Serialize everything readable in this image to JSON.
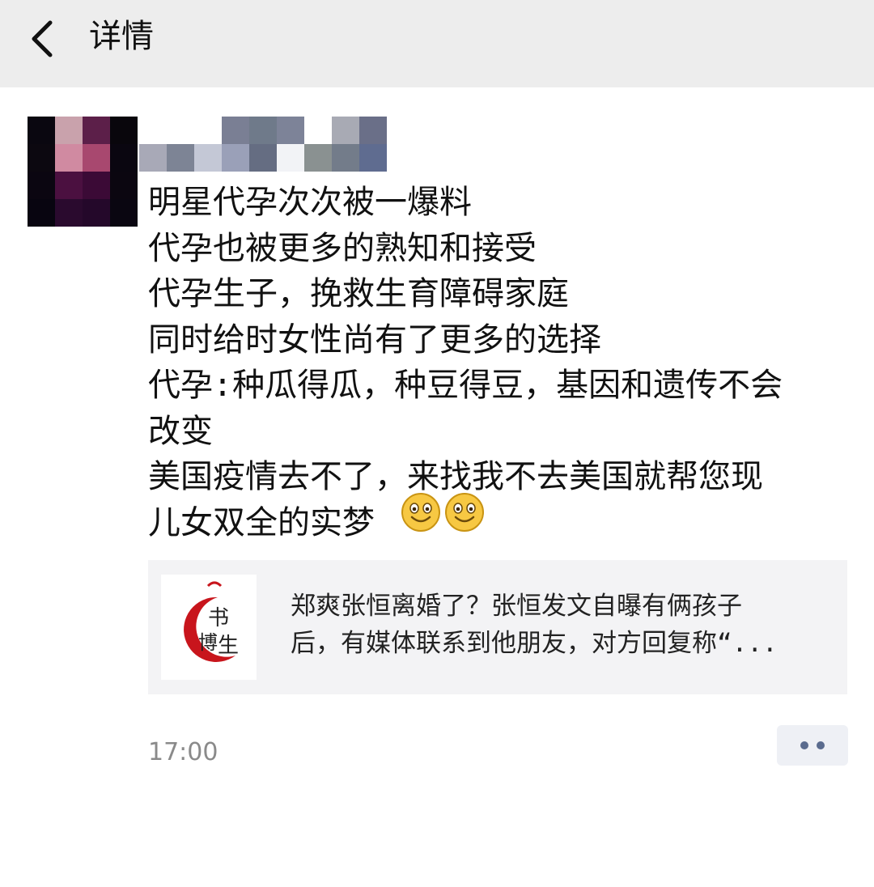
{
  "header": {
    "back_icon": "chevron-left-icon",
    "title": "详情"
  },
  "post": {
    "avatar": "avatar-pixelated",
    "nickname": "",
    "lines": [
      "明星代孕次次被一爆料",
      "代孕也被更多的熟知和接受",
      "代孕生子，挽救生育障碍家庭",
      "同时给时女性尚有了更多的选择",
      "代孕:种瓜得瓜，种豆得豆，基因和遗传不会",
      "改变",
      "美国疫情去不了，来找我不去美国就帮您现",
      "儿女双全的实梦"
    ],
    "emojis": [
      "smile-emoji",
      "smile-emoji"
    ],
    "link_card": {
      "thumb_logo_text": "书博生",
      "line1": "郑爽张恒离婚了？张恒发文自曝有俩孩子",
      "line2": "后，有媒体联系到他朋友，对方回复称“..."
    },
    "timestamp": "17:00",
    "more_icon": "more-dots-icon"
  },
  "colors": {
    "header_bg": "#ededed",
    "card_bg": "#f3f3f5",
    "link_dots": "#5a6b8e",
    "logo_red": "#c8151c",
    "timestamp": "#8a8a8a"
  }
}
